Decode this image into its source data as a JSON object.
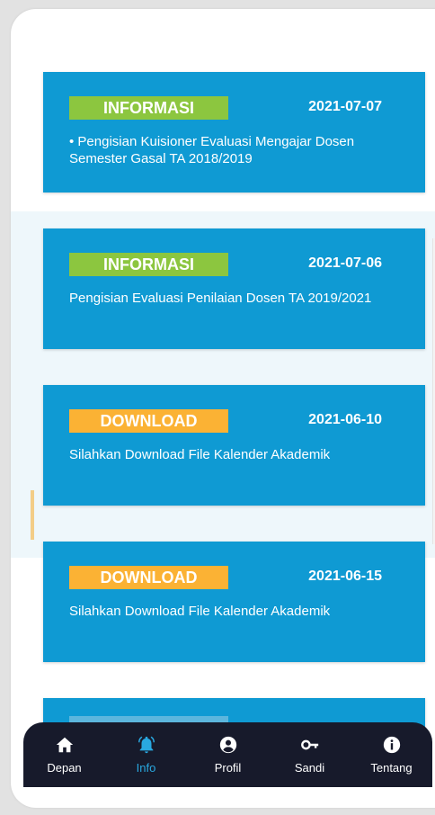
{
  "colors": {
    "card_bg": "#0f9ad3",
    "badge_informasi": "#8cc63f",
    "badge_download": "#fbb234",
    "nav_bg": "#171a2b",
    "nav_active": "#29a8e0"
  },
  "announcements": [
    {
      "category": "INFORMASI",
      "date": "2021-07-07",
      "text": "• Pengisian Kuisioner Evaluasi Mengajar Dosen Semester Gasal TA 2018/2019"
    },
    {
      "category": "INFORMASI",
      "date": "2021-07-06",
      "text": "Pengisian Evaluasi Penilaian Dosen TA 2019/2021"
    },
    {
      "category": "DOWNLOAD",
      "date": "2021-06-10",
      "text": "Silahkan Download File Kalender Akademik"
    },
    {
      "category": "DOWNLOAD",
      "date": "2021-06-15",
      "text": "Silahkan Download File Kalender Akademik"
    }
  ],
  "nav": {
    "items": [
      {
        "label": "Depan",
        "icon": "home-icon"
      },
      {
        "label": "Info",
        "icon": "bell-icon",
        "active": true
      },
      {
        "label": "Profil",
        "icon": "user-circle-icon"
      },
      {
        "label": "Sandi",
        "icon": "key-icon"
      },
      {
        "label": "Tentang",
        "icon": "info-circle-icon"
      }
    ]
  }
}
